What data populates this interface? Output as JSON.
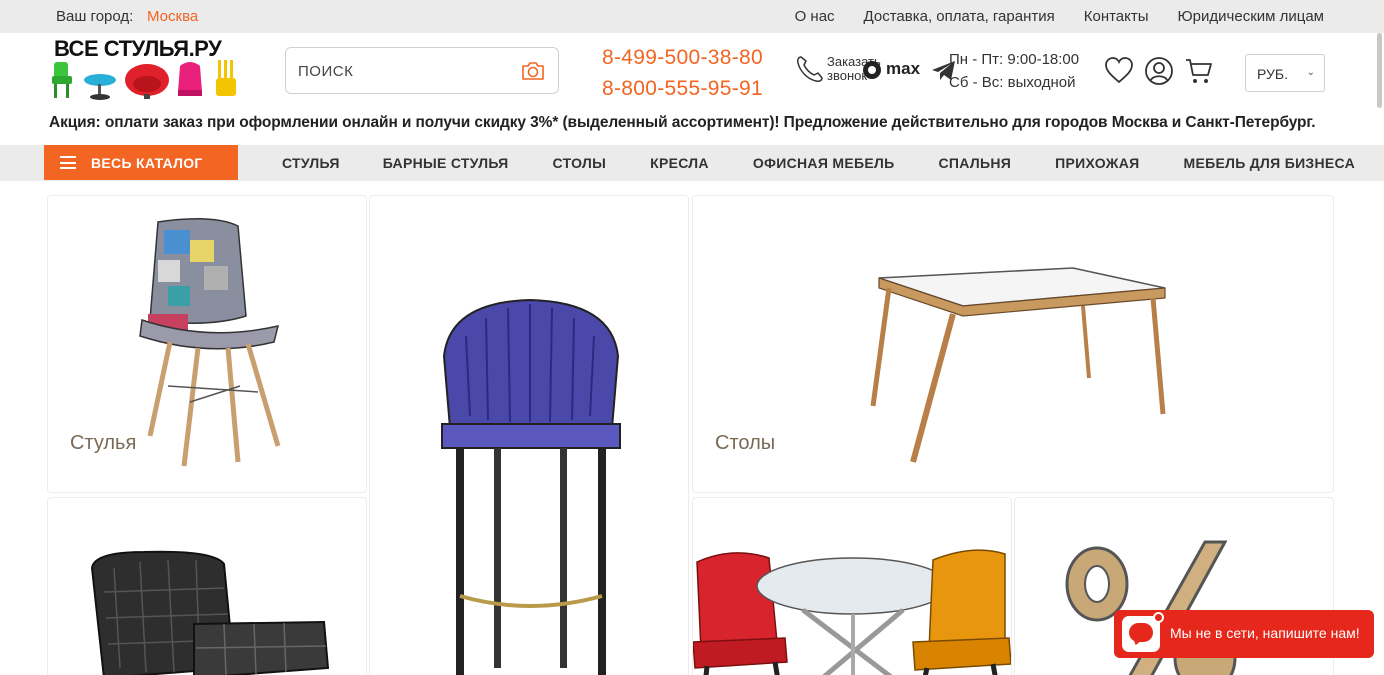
{
  "topbar": {
    "city_label": "Ваш город:",
    "city_value": "Москва",
    "links": [
      "О нас",
      "Доставка, оплата, гарантия",
      "Контакты",
      "Юридическим лицам"
    ]
  },
  "header": {
    "logo_text": "ВСЕ СТУЛЬЯ.РУ",
    "search_placeholder": "ПОИСК",
    "phones": [
      "8-499-500-38-80",
      "8-800-555-95-91"
    ],
    "callback_label": "Заказать звонок",
    "max_label": "max",
    "hours": [
      "Пн - Пт: 9:00-18:00",
      "Сб - Вс: выходной"
    ],
    "currency": "РУБ.",
    "icons": [
      "heart-icon",
      "user-icon",
      "cart-icon",
      "camera-icon",
      "phone-icon",
      "telegram-icon"
    ]
  },
  "promo": "Акция: оплати заказ при оформлении онлайн и получи скидку 3%* (выделенный ассортимент)! Предложение действительно для городов Москва и Санкт-Петербург.",
  "nav": {
    "catalog_label": "ВЕСЬ КАТАЛОГ",
    "items": [
      "СТУЛЬЯ",
      "БАРНЫЕ СТУЛЬЯ",
      "СТОЛЫ",
      "КРЕСЛА",
      "ОФИСНАЯ МЕБЕЛЬ",
      "СПАЛЬНЯ",
      "ПРИХОЖАЯ",
      "МЕБЕЛЬ ДЛЯ БИЗНЕСА"
    ]
  },
  "tiles": {
    "chairs_label": "Стулья",
    "tables_label": "Столы"
  },
  "chat": {
    "text": "Мы не в сети, напишите нам!"
  },
  "colors": {
    "accent": "#f26522",
    "chat_red": "#e5281b",
    "nav_bg": "#ebebeb"
  }
}
